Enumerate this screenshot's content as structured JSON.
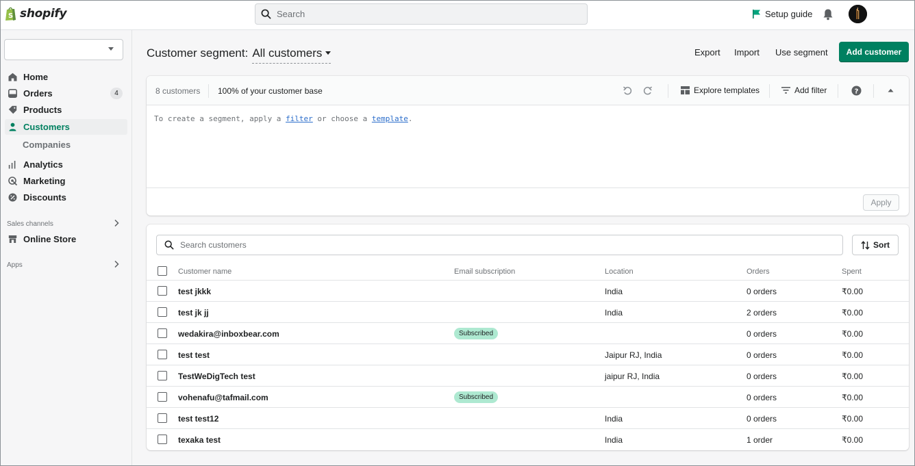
{
  "brand": {
    "name": "shopify",
    "color": "#008060"
  },
  "topbar": {
    "search_placeholder": "Search",
    "setup_guide": "Setup guide",
    "icons": [
      "search-icon",
      "flag-icon",
      "bell-icon",
      "avatar"
    ]
  },
  "sidebar": {
    "store_select_value": "",
    "items": [
      {
        "label": "Home",
        "icon": "home-icon"
      },
      {
        "label": "Orders",
        "icon": "orders-icon",
        "badge": "4"
      },
      {
        "label": "Products",
        "icon": "tag-icon"
      },
      {
        "label": "Customers",
        "icon": "person-icon",
        "active": true
      },
      {
        "label": "Companies"
      },
      {
        "label": "Analytics",
        "icon": "bar-chart-icon"
      },
      {
        "label": "Marketing",
        "icon": "marketing-icon"
      },
      {
        "label": "Discounts",
        "icon": "discount-icon"
      }
    ],
    "sales_channels_label": "Sales channels",
    "online_store": "Online Store",
    "apps_label": "Apps"
  },
  "header": {
    "title_prefix": "Customer segment:",
    "segment": "All customers",
    "export": "Export",
    "import": "Import",
    "use_segment": "Use segment",
    "add_customer": "Add customer"
  },
  "segment_card": {
    "count": "8 customers",
    "percent": "100% of your customer base",
    "explore_templates": "Explore templates",
    "add_filter": "Add filter",
    "editor_prefix": "To create a segment, apply a ",
    "editor_filter": "filter",
    "editor_mid": " or choose a ",
    "editor_template": "template",
    "editor_suffix": ".",
    "apply": "Apply"
  },
  "customers": {
    "search_placeholder": "Search customers",
    "sort": "Sort",
    "columns": [
      "Customer name",
      "Email subscription",
      "Location",
      "Orders",
      "Spent"
    ],
    "rows": [
      {
        "name": "test jkkk",
        "subscription": "",
        "location": "India",
        "orders": "0 orders",
        "spent": "₹0.00"
      },
      {
        "name": "test jk jj",
        "subscription": "",
        "location": "India",
        "orders": "2 orders",
        "spent": "₹0.00"
      },
      {
        "name": "wedakira@inboxbear.com",
        "subscription": "Subscribed",
        "location": "",
        "orders": "0 orders",
        "spent": "₹0.00"
      },
      {
        "name": "test test",
        "subscription": "",
        "location": "Jaipur RJ, India",
        "orders": "0 orders",
        "spent": "₹0.00"
      },
      {
        "name": "TestWeDigTech test",
        "subscription": "",
        "location": "jaipur RJ, India",
        "orders": "0 orders",
        "spent": "₹0.00"
      },
      {
        "name": "vohenafu@tafmail.com",
        "subscription": "Subscribed",
        "location": "",
        "orders": "0 orders",
        "spent": "₹0.00"
      },
      {
        "name": "test test12",
        "subscription": "",
        "location": "India",
        "orders": "0 orders",
        "spent": "₹0.00"
      },
      {
        "name": "texaka test",
        "subscription": "",
        "location": "India",
        "orders": "1 order",
        "spent": "₹0.00"
      }
    ]
  }
}
